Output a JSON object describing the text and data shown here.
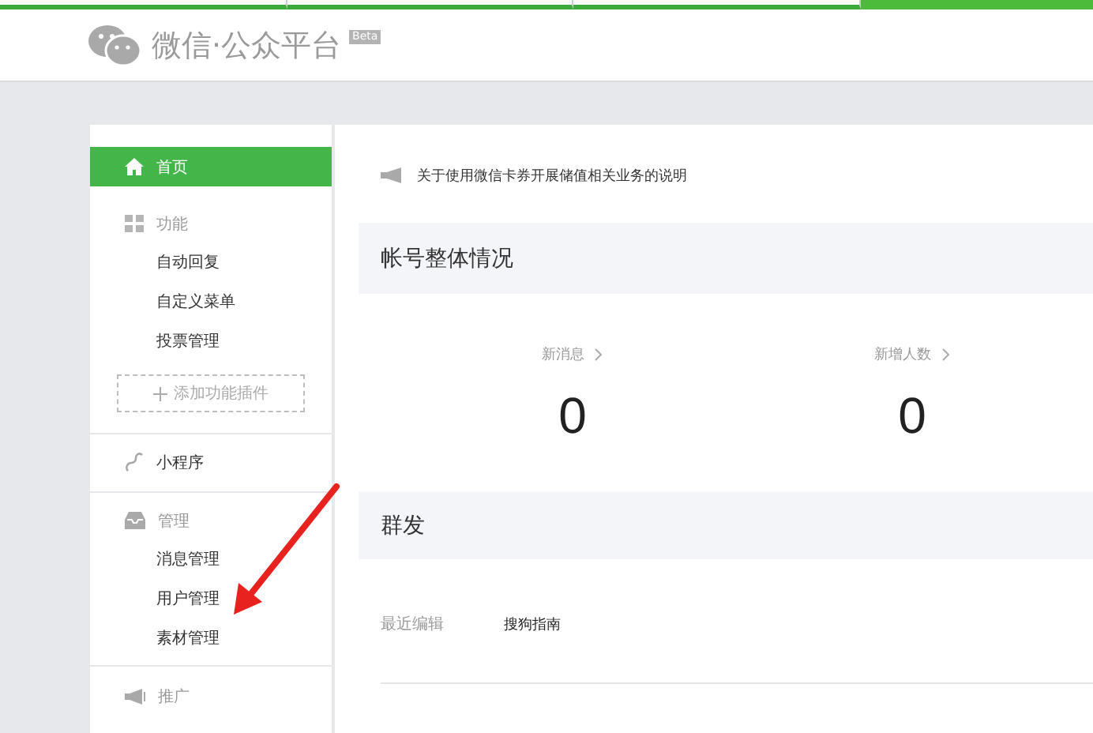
{
  "header": {
    "logo_text": "微信·公众平台",
    "badge": "Beta"
  },
  "sidebar": {
    "items": [
      {
        "kind": "link",
        "label": "首页",
        "selected": true
      },
      {
        "kind": "group",
        "label": "功能",
        "children": [
          {
            "label": "自动回复",
            "selected": false
          },
          {
            "label": "自定义菜单",
            "selected": false
          },
          {
            "label": "投票管理",
            "selected": false
          }
        ],
        "add_button": "添加功能插件"
      },
      {
        "kind": "link",
        "label": "小程序",
        "selected": false
      },
      {
        "kind": "group",
        "label": "管理",
        "children": [
          {
            "label": "消息管理",
            "selected": false
          },
          {
            "label": "用户管理",
            "selected": false
          },
          {
            "label": "素材管理",
            "selected": false
          }
        ]
      },
      {
        "kind": "group",
        "label": "推广"
      }
    ]
  },
  "notice": "关于使用微信卡券开展储值相关业务的说明",
  "account_section": {
    "title": "帐号整体情况",
    "stats": [
      {
        "label": "新消息",
        "value": "0"
      },
      {
        "label": "新增人数",
        "value": "0"
      }
    ]
  },
  "broadcast_section": {
    "title": "群发",
    "row_label": "最近编辑",
    "row_value": "搜狗指南"
  }
}
